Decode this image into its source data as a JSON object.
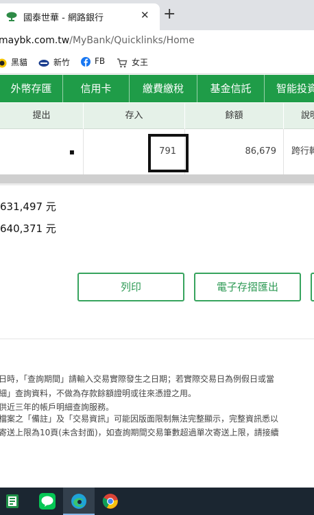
{
  "browser": {
    "tab_title": "國泰世華 - 網路銀行",
    "close_glyph": "✕",
    "newtab_glyph": "+",
    "url_host": "maybk.com.tw",
    "url_path": "/MyBank/Quicklinks/Home"
  },
  "bookmarks": [
    {
      "label": "黑貓",
      "icon": "cat-icon"
    },
    {
      "label": "新竹",
      "icon": "logo-icon"
    },
    {
      "label": "FB",
      "icon": "facebook-icon"
    },
    {
      "label": "女王",
      "icon": "cart-icon"
    }
  ],
  "nav": [
    "外幣存匯",
    "信用卡",
    "繳費繳稅",
    "基金信託",
    "智能投資"
  ],
  "table": {
    "headers": [
      "提出",
      "存入",
      "餘額",
      "說明"
    ],
    "row": {
      "withdraw": "▪",
      "deposit": "791",
      "balance": "86,679",
      "memo": "跨行轉"
    }
  },
  "totals": [
    "631,497 元",
    "640,371 元"
  ],
  "buttons": {
    "print": "列印",
    "export": "電子存摺匯出"
  },
  "notes": [
    "日時，「查詢期間」請輸入交易實際發生之日期；若實際交易日為例假日或當",
    "細」查詢資料，不做為存款餘額證明或往來憑證之用。",
    "供近三年的帳戶明細查詢服務。",
    "檔案之「備註」及「交易資訊」可能因版面限制無法完整顯示，完整資訊悉以",
    "寄送上限為10頁(未含封面)，如查詢期間交易筆數超過單次寄送上限，請接續"
  ],
  "colors": {
    "brand_green": "#1f9c48",
    "header_tint": "#e5f1e8"
  }
}
